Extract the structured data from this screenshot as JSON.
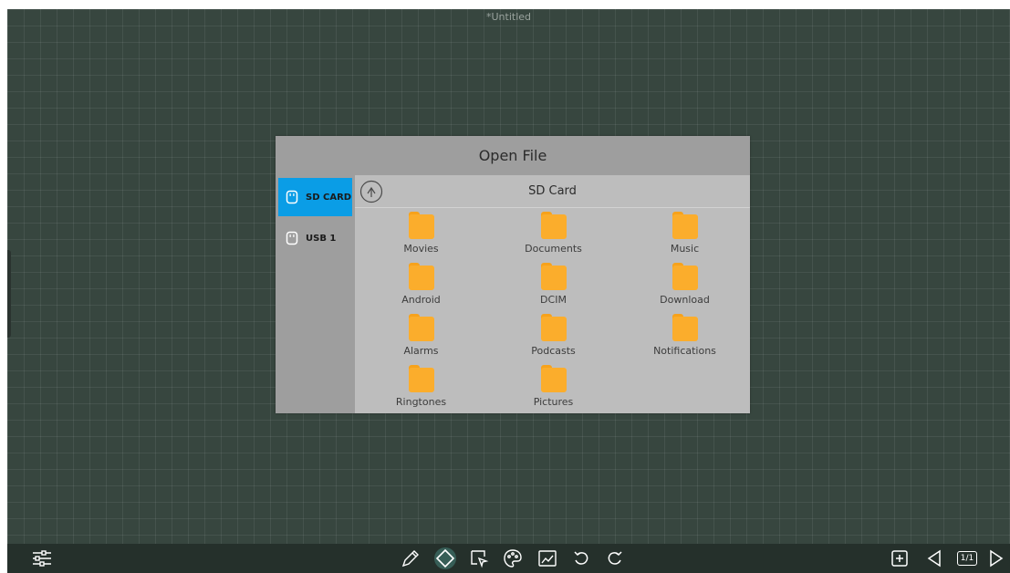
{
  "document": {
    "title": "*Untitled"
  },
  "dialog": {
    "title": "Open File",
    "drives": [
      {
        "label": "SD CARD",
        "icon": "usb-drive-icon",
        "selected": true
      },
      {
        "label": "USB 1",
        "icon": "usb-drive-icon",
        "selected": false
      }
    ],
    "current_path": "SD Card",
    "folders": [
      "Movies",
      "Documents",
      "Music",
      "Android",
      "DCIM",
      "Download",
      "Alarms",
      "Podcasts",
      "Notifications",
      "Ringtones",
      "Pictures"
    ]
  },
  "toolbar": {
    "page_indicator": "1/1",
    "tools": [
      "settings-sliders-icon",
      "pen-icon",
      "eraser-icon",
      "select-icon",
      "palette-icon",
      "insert-image-icon",
      "undo-icon",
      "redo-icon",
      "add-page-icon",
      "previous-page-icon",
      "next-page-icon"
    ]
  },
  "colors": {
    "board": "#37463f",
    "dialog_header": "#9e9e9e",
    "dialog_body": "#bdbdbd",
    "selected_drive": "#0a9de6",
    "folder": "#fbad2c",
    "toolbar": "#25302b"
  }
}
